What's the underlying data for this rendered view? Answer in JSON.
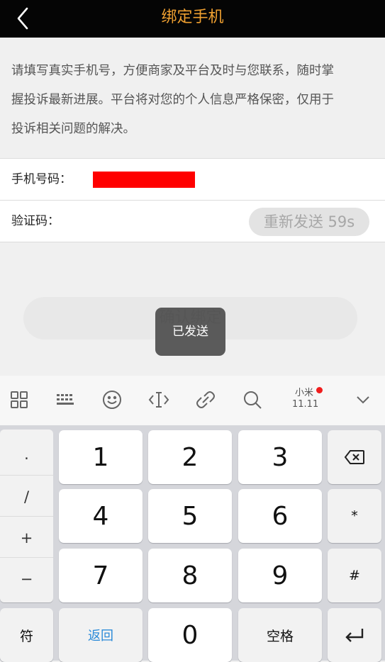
{
  "header": {
    "title": "绑定手机"
  },
  "notice": {
    "lines": [
      "请填写真实手机号，方便商家及平台及时与您联系，随时掌",
      "握投诉最新进展。平台将对您的个人信息严格保密，仅用于",
      "投诉相关问题的解决。"
    ]
  },
  "form": {
    "phone_label": "手机号码：",
    "phone_value": "",
    "code_label": "验证码：",
    "resend_label": "重新发送 59s"
  },
  "confirm_label": "确认绑定",
  "toast": "已发送",
  "toolbar": {
    "mi_brand": "小米",
    "mi_number": "11.11"
  },
  "keyboard": {
    "side_keys": [
      ".",
      "/",
      "+",
      "−"
    ],
    "symbol_key": "符",
    "digits": [
      "1",
      "2",
      "3",
      "4",
      "5",
      "6",
      "7",
      "8",
      "9",
      "0"
    ],
    "back_label": "返回",
    "space_label": "空格",
    "star_key": "*",
    "hash_key": "#"
  },
  "colors": {
    "header_bg": "#050505",
    "title": "#f0a030",
    "masked_phone": "#ff0000",
    "link_blue": "#2a8ad8"
  }
}
